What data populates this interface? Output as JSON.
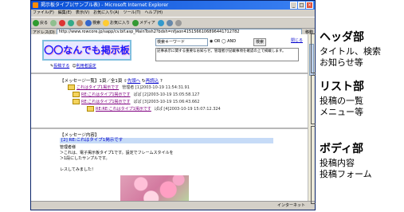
{
  "window": {
    "title": "掲示板タイプ1(サンプル表) - Microsoft Internet Explorer",
    "menus": [
      "ファイル(F)",
      "編集(E)",
      "表示(V)",
      "お気に入り(A)",
      "ツール(T)",
      "ヘルプ(H)"
    ],
    "toolbar": [
      "戻る",
      "",
      "検索",
      "お気に入り",
      "メディア"
    ],
    "address_label": "アドレス(D)",
    "address": "http://www.rowcore.jp/sapp/cv.bif.asp_MainTosh2?bdsh=nfjaon4151566106896441712782",
    "go_label": "移動",
    "status": "インターネット"
  },
  "header": {
    "logo": "〇〇なんでも掲示板",
    "links": [
      "投稿する",
      "利用者設定"
    ],
    "search_placeholder": "検索キーワード",
    "search_opts": "◉ OR ◯ AND",
    "search_button": "検索",
    "close_link": "閉じる",
    "notice": "記事表示に関する重要なお知らせ。管理者が記載事項を確認の上で掲載します。"
  },
  "list": {
    "heading": "【メッセージ一覧】1頁／全1頁 ",
    "heading_links": [
      "先頭へ",
      "再読込"
    ],
    "rows": [
      {
        "title": "これはタイプ1掲示です",
        "meta": "管理者 [1]2003-10-19 11:54:31.91"
      },
      {
        "title": "RE:これはタイプ1掲示です",
        "meta": "ぱぱ [2]2003-10-19 15:05:58.127"
      },
      {
        "title": "RE:これはタイプ1掲示です",
        "meta": "ぱぱ [3]2003-10-19 15:06:43.662"
      },
      {
        "title": "RE:RE:これはタイプ1掲示です",
        "meta": "ぱぱ [4]2003-10-19 15:07:12.324"
      }
    ]
  },
  "body": {
    "heading": "【メッセージ内容】",
    "subject": "[2] RE:これはタイプ1掲示です",
    "text": "管理者様\n＞これは、電子掲示板タイプ1です。設定でフレームスタイルを\n＞1段にしたサンプルです。\n\nレスしてみました！"
  },
  "annotations": [
    {
      "title": "ヘッダ部",
      "desc": [
        "タイトル、検索",
        "お知らせ等"
      ]
    },
    {
      "title": "リスト部",
      "desc": [
        "投稿の一覧",
        "メニュー等"
      ]
    },
    {
      "title": "ボディ部",
      "desc": [
        "投稿内容",
        "投稿フォーム"
      ]
    }
  ]
}
